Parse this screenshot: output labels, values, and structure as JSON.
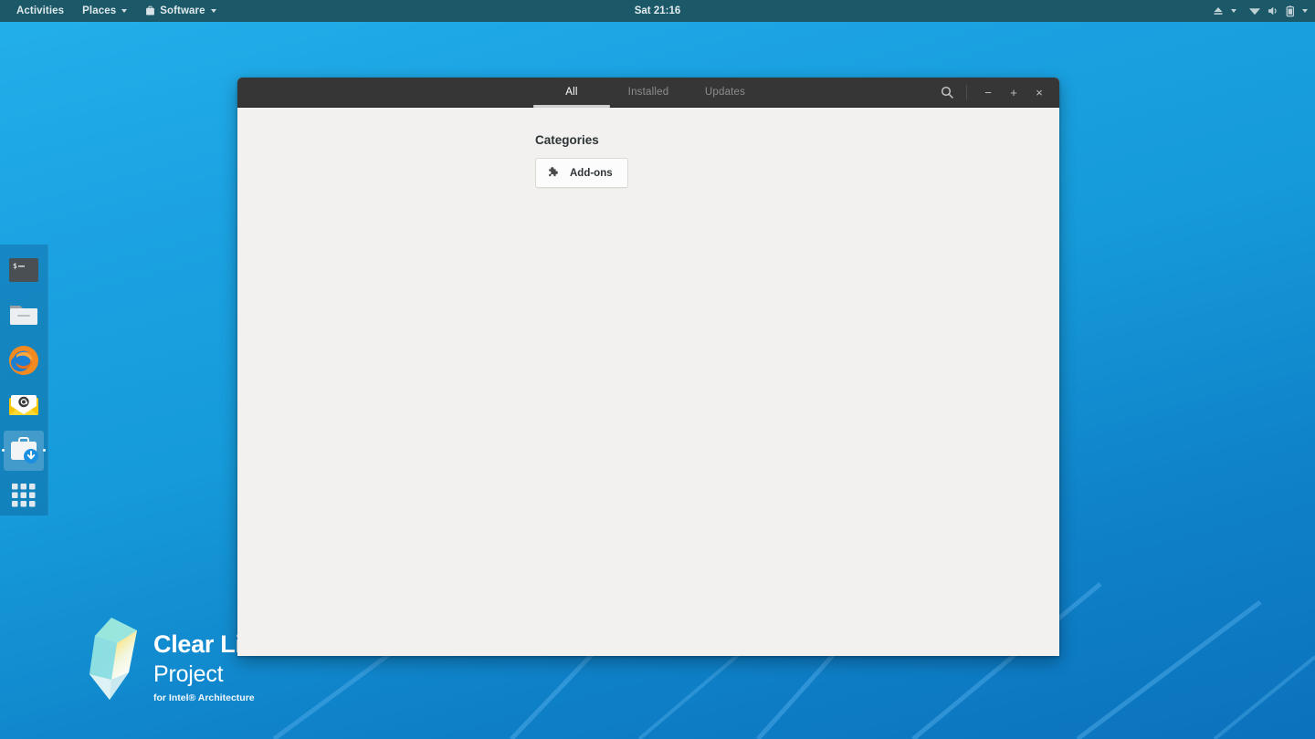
{
  "topbar": {
    "activities_label": "Activities",
    "places_label": "Places",
    "app_menu_label": "Software",
    "app_menu_icon": "briefcase-icon",
    "clock": "Sat 21:16",
    "tray": [
      {
        "name": "eject-icon",
        "label": "Eject"
      },
      {
        "name": "tray-dropdown-icon",
        "label": "Menu"
      },
      {
        "name": "wifi-icon",
        "label": "Network"
      },
      {
        "name": "volume-icon",
        "label": "Volume"
      },
      {
        "name": "battery-icon",
        "label": "Battery"
      },
      {
        "name": "system-menu-dropdown-icon",
        "label": "System menu"
      }
    ]
  },
  "dock": {
    "items": [
      {
        "name": "dock-item-terminal",
        "label": "Terminal",
        "active": false
      },
      {
        "name": "dock-item-files",
        "label": "Files",
        "active": false
      },
      {
        "name": "dock-item-firefox",
        "label": "Firefox",
        "active": false
      },
      {
        "name": "dock-item-mail",
        "label": "Mail",
        "active": false
      },
      {
        "name": "dock-item-software",
        "label": "Software",
        "active": true
      },
      {
        "name": "dock-item-show-apps",
        "label": "Show Applications",
        "active": false
      }
    ]
  },
  "desktop": {
    "logo": {
      "title": "Clear Linux",
      "subtitle": "Project",
      "tagline": "for Intel® Architecture"
    }
  },
  "window": {
    "tabs": [
      {
        "label": "All",
        "active": true
      },
      {
        "label": "Installed",
        "active": false
      },
      {
        "label": "Updates",
        "active": false
      }
    ],
    "controls": {
      "search": "search-icon",
      "minimize": "−",
      "maximize": "+",
      "close": "×"
    },
    "content": {
      "categories_heading": "Categories",
      "categories": [
        {
          "label": "Add-ons",
          "icon": "puzzle-piece-icon"
        }
      ]
    }
  },
  "colors": {
    "topbar_bg": "#1b5868",
    "wallpaper_top": "#23b0ea",
    "wallpaper_bottom": "#0b72bd",
    "titlebar_bg": "#363636",
    "window_body_bg": "#f2f1f0",
    "accent": "#1b6acb"
  }
}
